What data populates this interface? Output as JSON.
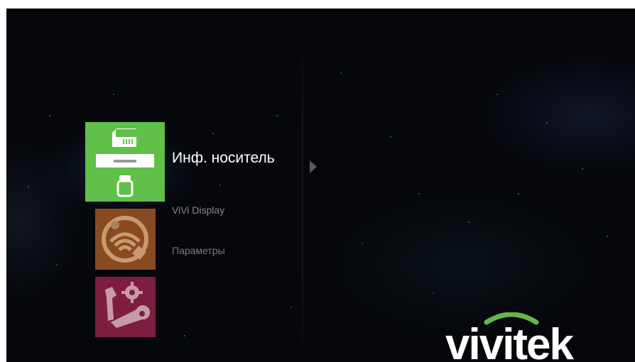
{
  "menu": {
    "items": [
      {
        "label": "Инф. носитель",
        "icon": "media-storage-icon",
        "color": "#5fc04a",
        "selected": true
      },
      {
        "label": "ViVi Display",
        "icon": "wireless-display-icon",
        "color": "#8a4a1f",
        "selected": false
      },
      {
        "label": "Параметры",
        "icon": "settings-tools-icon",
        "color": "#7d1e40",
        "selected": false
      }
    ]
  },
  "logo": {
    "text": "vivitek",
    "text_color": "#ffffff",
    "arc_color": "#62b84a"
  },
  "colors": {
    "background": "#05070b",
    "selected_label": "#ffffff",
    "inactive_label": "#8a8a8a"
  }
}
